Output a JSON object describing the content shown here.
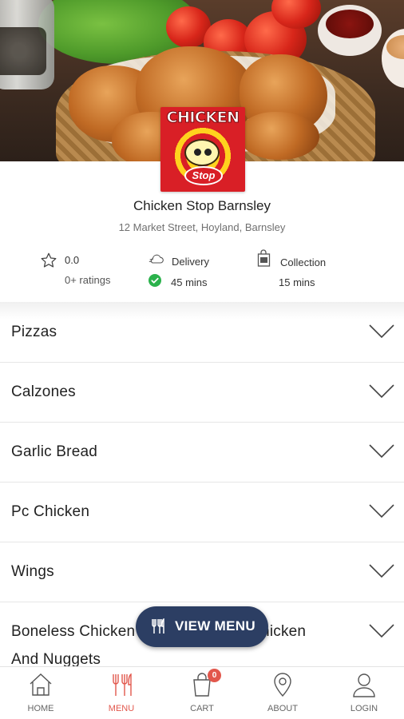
{
  "restaurant": {
    "name": "Chicken Stop Barnsley",
    "address": "12 Market Street, Hoyland, Barnsley",
    "logo_text": "CHICKEN",
    "logo_subtext": "Stop"
  },
  "stats": {
    "rating_value": "0.0",
    "rating_count": "0+ ratings",
    "delivery_label": "Delivery",
    "delivery_time": "45 mins",
    "collection_label": "Collection",
    "collection_time": "15 mins"
  },
  "categories": [
    {
      "label": "Pizzas"
    },
    {
      "label": "Calzones"
    },
    {
      "label": "Garlic Bread"
    },
    {
      "label": "Pc Chicken"
    },
    {
      "label": "Wings"
    },
    {
      "label_line1": "Boneless Chicken Strips, Popcorn Chicken",
      "label_line2": "And Nuggets"
    }
  ],
  "fab": {
    "label": "VIEW MENU",
    "icon": "cutlery-icon"
  },
  "nav": [
    {
      "label": "HOME",
      "icon": "home-icon"
    },
    {
      "label": "MENU",
      "icon": "cutlery-icon",
      "active": true
    },
    {
      "label": "CART",
      "icon": "cart-icon",
      "badge": "0"
    },
    {
      "label": "ABOUT",
      "icon": "location-pin-icon"
    },
    {
      "label": "LOGIN",
      "icon": "user-icon"
    }
  ],
  "colors": {
    "accent": "#e2574c",
    "fab_bg": "#2c3e63",
    "check_green": "#2bb24c",
    "logo_red": "#d91f26"
  }
}
